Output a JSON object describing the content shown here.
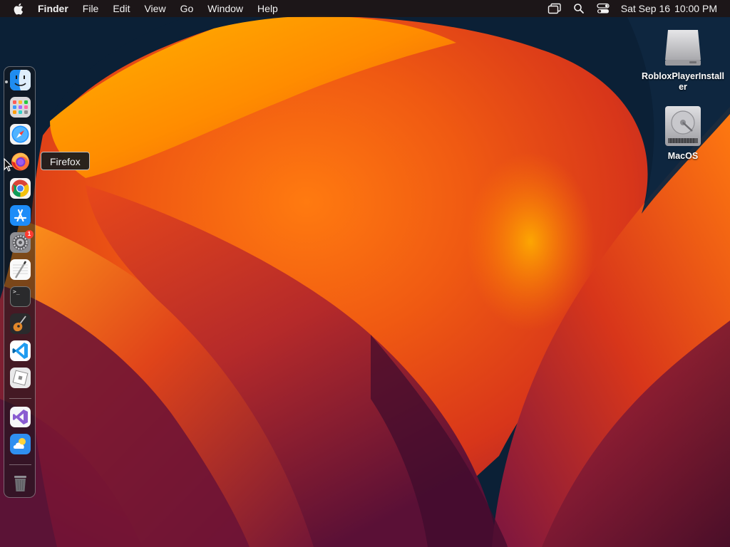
{
  "menubar": {
    "apple_icon": "apple-logo-icon",
    "app_name": "Finder",
    "menus": [
      "File",
      "Edit",
      "View",
      "Go",
      "Window",
      "Help"
    ],
    "status_icons": [
      "screen-mirroring-icon",
      "spotlight-search-icon",
      "control-center-icon"
    ],
    "clock": {
      "date": "Sat Sep 16",
      "time": "10:00 PM"
    }
  },
  "dock": {
    "apps": [
      {
        "name": "Finder",
        "icon": "finder-icon",
        "running": true
      },
      {
        "name": "Launchpad",
        "icon": "launchpad-icon"
      },
      {
        "name": "Safari",
        "icon": "safari-icon"
      },
      {
        "name": "Firefox",
        "icon": "firefox-icon"
      },
      {
        "name": "Google Chrome",
        "icon": "chrome-icon"
      },
      {
        "name": "App Store",
        "icon": "app-store-icon"
      },
      {
        "name": "System Settings",
        "icon": "system-settings-icon",
        "badge": "1"
      },
      {
        "name": "TextEdit",
        "icon": "textedit-icon"
      },
      {
        "name": "Terminal",
        "icon": "terminal-icon",
        "glyph": ">_"
      },
      {
        "name": "GarageBand",
        "icon": "garageband-icon"
      },
      {
        "name": "Visual Studio Code",
        "icon": "vscode-icon"
      },
      {
        "name": "Roblox",
        "icon": "roblox-icon"
      },
      {
        "name": "Visual Studio",
        "icon": "visual-studio-icon"
      },
      {
        "name": "Weather",
        "icon": "weather-icon"
      },
      {
        "name": "Trash",
        "icon": "trash-icon"
      }
    ],
    "tooltip": "Firefox"
  },
  "desktop": {
    "items": [
      {
        "label": "RobloxPlayerInstaller",
        "icon": "disk-image-icon"
      },
      {
        "label": "MacOS",
        "icon": "hard-drive-icon"
      }
    ]
  },
  "colors": {
    "wallpaper_base": "#0b2036",
    "wallpaper_orange": "#ff8a00",
    "wallpaper_red": "#e0301a",
    "wallpaper_magenta": "#8a1c4a",
    "menubar_bg": "#1e1616",
    "badge_red": "#ff3b30"
  }
}
